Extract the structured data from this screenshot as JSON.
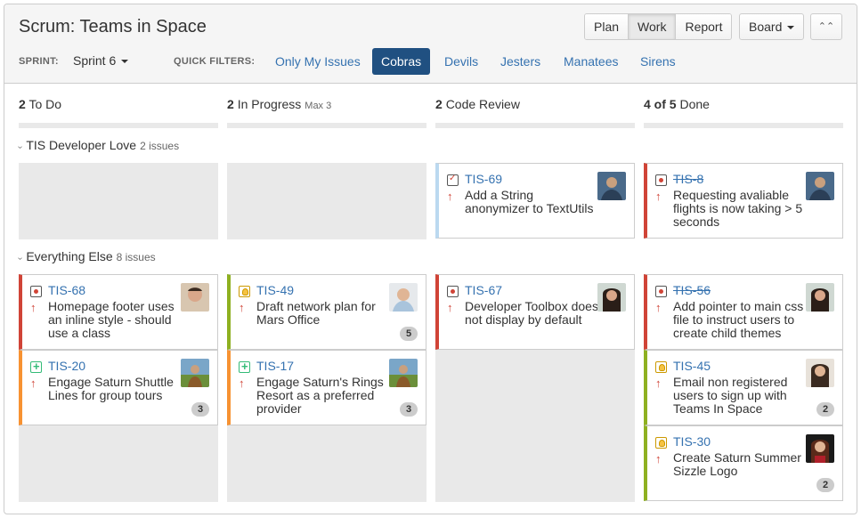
{
  "title": "Scrum: Teams in Space",
  "modes": [
    "Plan",
    "Work",
    "Report"
  ],
  "board_label": "Board",
  "sprint_label": "SPRINT:",
  "sprint_value": "Sprint 6",
  "quick_filters_label": "QUICK FILTERS:",
  "quick_filters": [
    "Only My Issues",
    "Cobras",
    "Devils",
    "Jesters",
    "Manatees",
    "Sirens"
  ],
  "active_filter": "Cobras",
  "columns": [
    {
      "count": "2",
      "name": "To Do",
      "extra": ""
    },
    {
      "count": "2",
      "name": "In Progress",
      "extra": "Max 3"
    },
    {
      "count": "2",
      "name": "Code Review",
      "extra": ""
    },
    {
      "count": "4 of 5",
      "name": "Done",
      "extra": ""
    }
  ],
  "swimlanes": [
    {
      "name": "TIS Developer Love",
      "count": "2 issues"
    },
    {
      "name": "Everything Else",
      "count": "8 issues"
    }
  ],
  "cards": [
    {
      "key": "TIS-69",
      "summary": "Add a String anonymizer to TextUtils",
      "type": "task",
      "done": false,
      "estimate": ""
    },
    {
      "key": "TIS-8",
      "summary": "Requesting avaliable flights is now taking > 5 seconds",
      "type": "bug",
      "done": true,
      "estimate": ""
    },
    {
      "key": "TIS-68",
      "summary": "Homepage footer uses an inline style - should use a class",
      "type": "bug",
      "done": false,
      "estimate": ""
    },
    {
      "key": "TIS-49",
      "summary": "Draft network plan for Mars Office",
      "type": "idea",
      "done": false,
      "estimate": "5"
    },
    {
      "key": "TIS-67",
      "summary": "Developer Toolbox does not display by default",
      "type": "bug",
      "done": false,
      "estimate": ""
    },
    {
      "key": "TIS-56",
      "summary": "Add pointer to main css file to instruct users to create child themes",
      "type": "bug",
      "done": true,
      "estimate": ""
    },
    {
      "key": "TIS-20",
      "summary": "Engage Saturn Shuttle Lines for group tours",
      "type": "story",
      "done": false,
      "estimate": "3"
    },
    {
      "key": "TIS-17",
      "summary": "Engage Saturn's Rings Resort as a preferred provider",
      "type": "story",
      "done": false,
      "estimate": "3"
    },
    {
      "key": "TIS-45",
      "summary": "Email non registered users to sign up with Teams In Space",
      "type": "idea",
      "done": false,
      "estimate": "2"
    },
    {
      "key": "TIS-30",
      "summary": "Create Saturn Summer Sizzle Logo",
      "type": "idea",
      "done": false,
      "estimate": "2"
    }
  ],
  "colors": {
    "blue": "#3572b0",
    "active_filter_bg": "#205081",
    "bug": "#d04437",
    "story": "#f79232",
    "done_green": "#8eb021",
    "review_blue": "#bbd9f0"
  }
}
